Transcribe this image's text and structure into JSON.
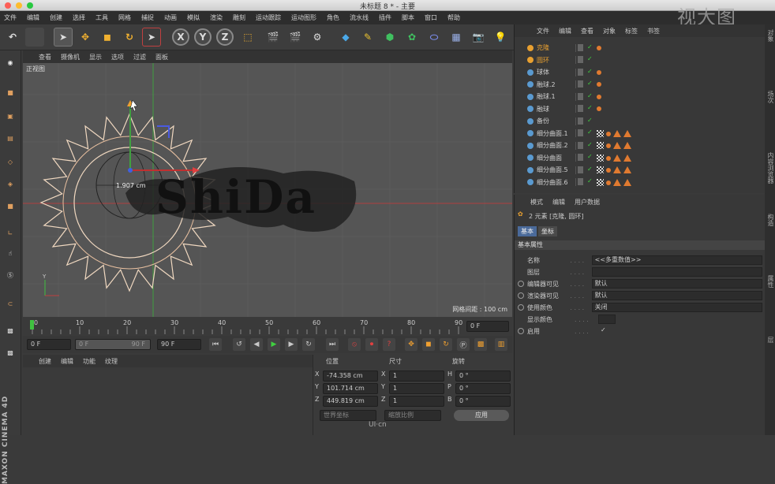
{
  "window": {
    "title": "未标题 8 * - 主要"
  },
  "watermark": "视大图",
  "menubar": [
    "文件",
    "编辑",
    "创建",
    "选择",
    "工具",
    "网格",
    "捕捉",
    "动画",
    "模拟",
    "渲染",
    "雕刻",
    "运动跟踪",
    "运动图形",
    "角色",
    "流水线",
    "插件",
    "脚本",
    "窗口",
    "帮助"
  ],
  "viewport": {
    "menu": [
      "查看",
      "摄像机",
      "显示",
      "选项",
      "过滤",
      "面板"
    ],
    "label": "正视图",
    "grid_spacing": "网格间距 : 100 cm",
    "measure": "1.907 cm",
    "text_object": "ShiDa"
  },
  "timeline": {
    "ticks": [
      "0",
      "10",
      "20",
      "30",
      "40",
      "50",
      "60",
      "70",
      "80",
      "90"
    ],
    "current_frame": "0 F",
    "start": "0 F",
    "range_start": "0 F",
    "range_end": "90 F",
    "end": "90 F"
  },
  "material": {
    "menu": [
      "创建",
      "编辑",
      "功能",
      "纹理"
    ]
  },
  "coords": {
    "headers": {
      "position": "位置",
      "size": "尺寸",
      "rotation": "旋转"
    },
    "rows": [
      {
        "axis": "X",
        "pos": "-74.358 cm",
        "saxis": "X",
        "size": "1",
        "raxis": "H",
        "rot": "0 °"
      },
      {
        "axis": "Y",
        "pos": "101.714 cm",
        "saxis": "Y",
        "size": "1",
        "raxis": "P",
        "rot": "0 °"
      },
      {
        "axis": "Z",
        "pos": "449.819 cm",
        "saxis": "Z",
        "size": "1",
        "raxis": "B",
        "rot": "0 °"
      }
    ],
    "mode1": "世界坐标",
    "mode2": "缩放比例",
    "apply": "应用"
  },
  "objects": {
    "menu": [
      "文件",
      "编辑",
      "查看",
      "对象",
      "标签",
      "书签"
    ],
    "items": [
      {
        "name": "克隆",
        "color": "#e8a030",
        "tags": "dots"
      },
      {
        "name": "圆环",
        "color": "#e8a030",
        "tags": "none"
      },
      {
        "name": "球体",
        "color": "#cfcfcf",
        "tags": "dots"
      },
      {
        "name": "融球.2",
        "color": "#cfcfcf",
        "tags": "dots"
      },
      {
        "name": "融球.1",
        "color": "#cfcfcf",
        "tags": "dots"
      },
      {
        "name": "融球",
        "color": "#cfcfcf",
        "tags": "dots"
      },
      {
        "name": "备份",
        "color": "#cfcfcf",
        "tags": "none"
      },
      {
        "name": "细分曲面.1",
        "color": "#cfcfcf",
        "tags": "full"
      },
      {
        "name": "细分曲面.2",
        "color": "#cfcfcf",
        "tags": "full"
      },
      {
        "name": "细分曲面",
        "color": "#cfcfcf",
        "tags": "full"
      },
      {
        "name": "细分曲面.5",
        "color": "#cfcfcf",
        "tags": "full"
      },
      {
        "name": "细分曲面.6",
        "color": "#cfcfcf",
        "tags": "full"
      }
    ]
  },
  "attributes": {
    "menu": [
      "模式",
      "编辑",
      "用户数据"
    ],
    "element_info": "2 元素 [克隆, 圆环]",
    "tabs": [
      "基本",
      "坐标"
    ],
    "section": "基本属性",
    "fields": [
      {
        "label": "名称",
        "value": "<<多重数值>>",
        "radio": false
      },
      {
        "label": "图层",
        "value": "",
        "radio": false
      },
      {
        "label": "编辑器可见",
        "value": "默认",
        "radio": true
      },
      {
        "label": "渲染器可见",
        "value": "默认",
        "radio": true
      },
      {
        "label": "使用颜色",
        "value": "关闭",
        "radio": true
      },
      {
        "label": "显示颜色",
        "value": "",
        "radio": false
      },
      {
        "label": "启用",
        "value": "✓",
        "radio": true
      }
    ]
  },
  "right_strip": [
    "对象",
    "场次",
    "内容浏览器",
    "构造",
    "属性",
    "层"
  ],
  "brand": "MAXON CINEMA 4D",
  "footer_logo": "UI·cn",
  "colors": {
    "accent": "#e07a30",
    "selected": "#e8a030",
    "active_tab": "#4a6a9a"
  }
}
